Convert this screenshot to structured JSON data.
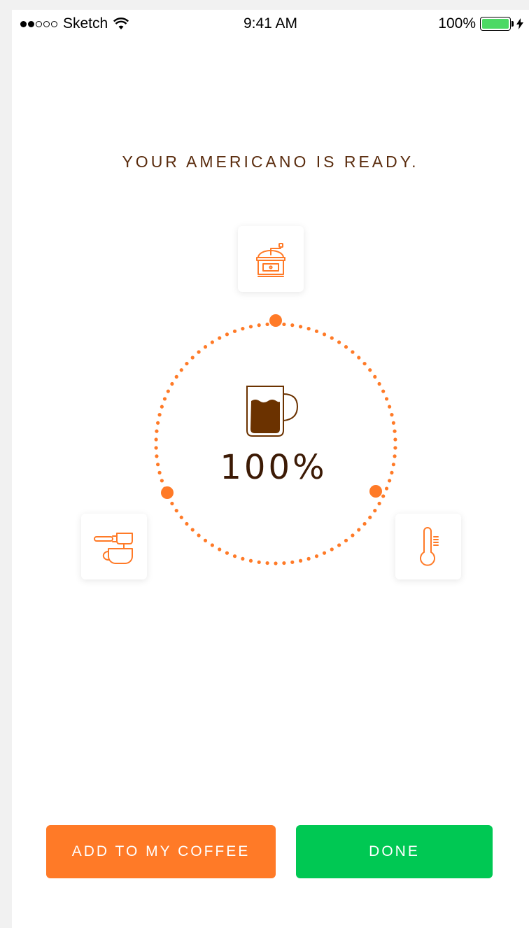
{
  "status_bar": {
    "carrier": "Sketch",
    "time": "9:41 AM",
    "battery_percent": "100%",
    "battery_level": 1.0,
    "signal_bars_filled": 2,
    "signal_bars_total": 5,
    "battery_color": "#4cd964"
  },
  "heading": "YOUR AMERICANO IS READY.",
  "progress": {
    "label": "100%",
    "value": 1.0,
    "ring_color": "#ff7a27"
  },
  "steps": [
    {
      "name": "grinder",
      "icon": "coffee-grinder-icon"
    },
    {
      "name": "brew",
      "icon": "portafilter-cup-icon"
    },
    {
      "name": "temperature",
      "icon": "thermometer-icon"
    }
  ],
  "buttons": {
    "add_label": "ADD TO MY COFFEE",
    "done_label": "DONE"
  },
  "colors": {
    "accent_orange": "#ff7a27",
    "done_green": "#00c853",
    "heading_brown": "#5a2c0e",
    "coffee_brown": "#6b3200"
  }
}
